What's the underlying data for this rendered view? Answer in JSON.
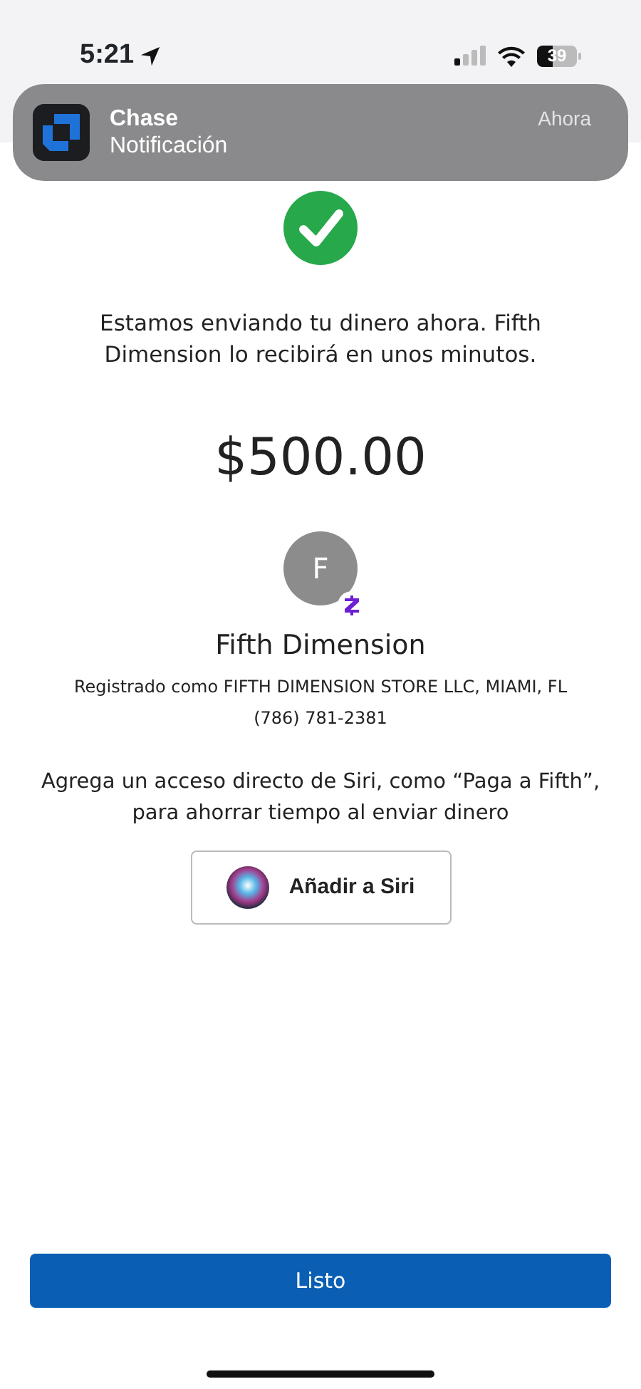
{
  "status_bar": {
    "time": "5:21",
    "battery": "39"
  },
  "notification": {
    "app": "Chase",
    "message": "Notificación",
    "time": "Ahora"
  },
  "confirmation": {
    "message": "Estamos enviando tu dinero ahora. Fifth Dimension lo recibirá en unos minutos.",
    "amount": "$500.00"
  },
  "recipient": {
    "initial": "F",
    "name": "Fifth Dimension",
    "registered": "Registrado como FIFTH DIMENSION STORE LLC, MIAMI, FL",
    "phone": "(786) 781-2381"
  },
  "siri": {
    "prompt": "Agrega un acceso directo de Siri, como “Paga a Fifth”, para ahorrar tiempo al enviar dinero",
    "button": "Añadir a Siri"
  },
  "done_button": "Listo"
}
